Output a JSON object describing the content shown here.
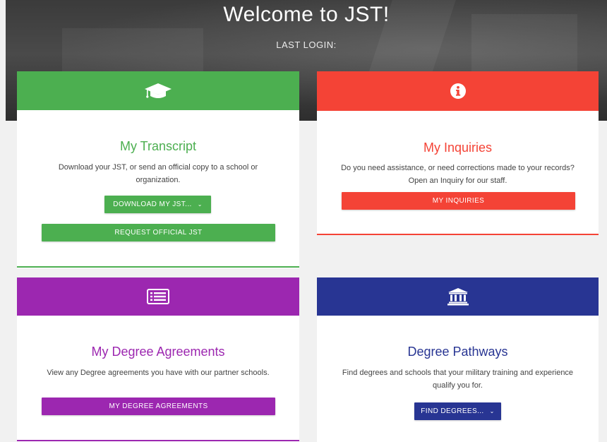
{
  "header": {
    "title": "Welcome to JST!",
    "last_login": "LAST LOGIN:"
  },
  "colors": {
    "green": "#4caf50",
    "red": "#f44336",
    "purple": "#9c27b0",
    "navy": "#283593"
  },
  "cards": {
    "transcript": {
      "icon": "graduation-cap-icon",
      "title": "My Transcript",
      "description": "Download your JST, or send an official copy to a school or organization.",
      "download_label": "DOWNLOAD MY JST...",
      "request_label": "REQUEST OFFICIAL JST"
    },
    "inquiries": {
      "icon": "info-icon",
      "title": "My Inquiries",
      "description": "Do you need assistance, or need corrections made to your records? Open an Inquiry for our staff.",
      "button_label": "MY INQUIRIES"
    },
    "degree_agreements": {
      "icon": "list-document-icon",
      "title": "My Degree Agreements",
      "description": "View any Degree agreements you have with our partner schools.",
      "button_label": "MY DEGREE AGREEMENTS"
    },
    "degree_pathways": {
      "icon": "institution-icon",
      "title": "Degree Pathways",
      "description": "Find degrees and schools that your military training and experience qualify you for.",
      "button_label": "FIND DEGREES..."
    }
  }
}
